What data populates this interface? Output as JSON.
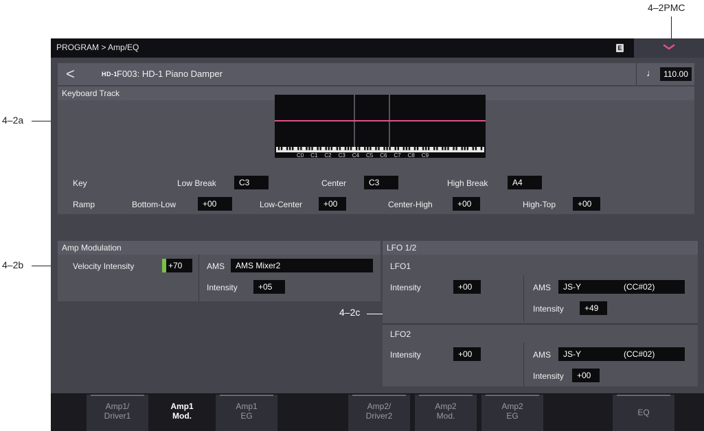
{
  "callouts": {
    "pmc": "4–2PMC",
    "a": "4–2a",
    "b": "4–2b",
    "c": "4–2c"
  },
  "topbar": {
    "breadcrumb": "PROGRAM > Amp/EQ",
    "badge": "E"
  },
  "header": {
    "hd1": "HD-1",
    "program_name": "F003: HD-1 Piano Damper",
    "tempo_symbol": "♩",
    "tempo": "110.00"
  },
  "keyboard_track": {
    "title": "Keyboard Track",
    "graph_notes": [
      "C0",
      "C1",
      "C2",
      "C3",
      "C4",
      "C5",
      "C6",
      "C7",
      "C8",
      "C9"
    ],
    "line_color": "#e0508a",
    "key_label": "Key",
    "low_break_label": "Low Break",
    "low_break": "C3",
    "center_label": "Center",
    "center": "C3",
    "high_break_label": "High Break",
    "high_break": "A4",
    "ramp_label": "Ramp",
    "bottom_low_label": "Bottom-Low",
    "bottom_low": "+00",
    "low_center_label": "Low-Center",
    "low_center": "+00",
    "center_high_label": "Center-High",
    "center_high": "+00",
    "high_top_label": "High-Top",
    "high_top": "+00"
  },
  "amp_mod": {
    "title": "Amp Modulation",
    "velocity_label": "Velocity Intensity",
    "velocity": "+70",
    "ams_label": "AMS",
    "ams": "AMS Mixer2",
    "intensity_label": "Intensity",
    "intensity": "+05"
  },
  "lfo": {
    "title": "LFO 1/2",
    "lfo1": {
      "name": "LFO1",
      "intensity_label": "Intensity",
      "intensity": "+00",
      "ams_label": "AMS",
      "ams": "JS-Y",
      "ams_cc": "(CC#02)",
      "ams_intensity_label": "Intensity",
      "ams_intensity": "+49"
    },
    "lfo2": {
      "name": "LFO2",
      "intensity_label": "Intensity",
      "intensity": "+00",
      "ams_label": "AMS",
      "ams": "JS-Y",
      "ams_cc": "(CC#02)",
      "ams_intensity_label": "Intensity",
      "ams_intensity": "+00"
    }
  },
  "tabs": [
    {
      "line1": "Amp1/",
      "line2": "Driver1"
    },
    {
      "line1": "Amp1",
      "line2": "Mod."
    },
    {
      "line1": "Amp1",
      "line2": "EG"
    },
    {
      "line1": "Amp2/",
      "line2": "Driver2"
    },
    {
      "line1": "Amp2",
      "line2": "Mod."
    },
    {
      "line1": "Amp2",
      "line2": "EG"
    },
    {
      "line1": "EQ",
      "line2": ""
    }
  ]
}
